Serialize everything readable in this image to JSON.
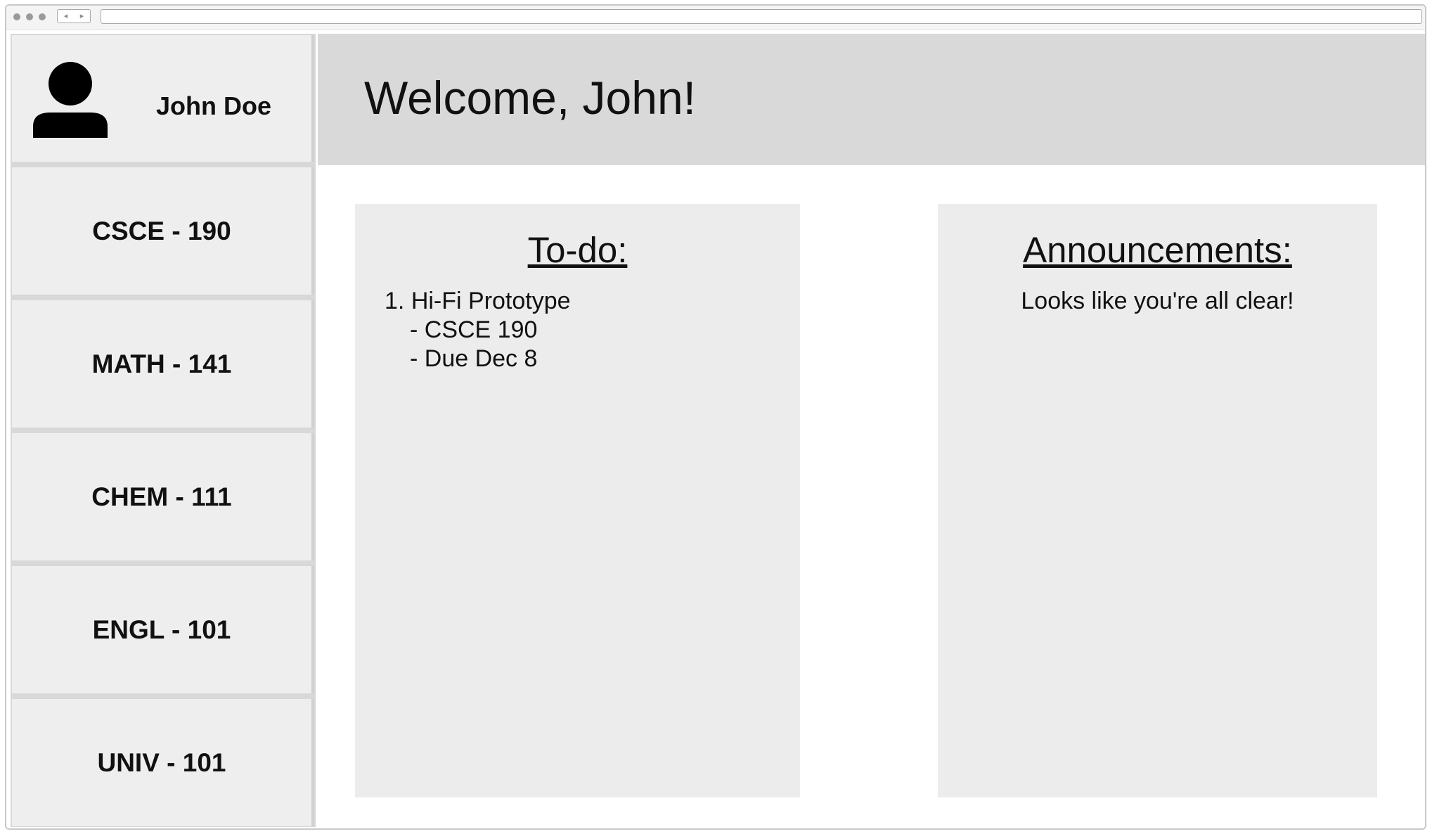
{
  "browser": {
    "back_glyph": "◂",
    "forward_glyph": "▸"
  },
  "sidebar": {
    "user_name": "John Doe",
    "avatar_icon": "user-icon",
    "courses": [
      {
        "label": "CSCE - 190"
      },
      {
        "label": "MATH - 141"
      },
      {
        "label": "CHEM - 111"
      },
      {
        "label": "ENGL - 101"
      },
      {
        "label": "UNIV - 101"
      }
    ]
  },
  "header": {
    "welcome": "Welcome, John!"
  },
  "todo": {
    "title": "To-do:",
    "items": [
      {
        "number": "1.",
        "name": "Hi-Fi Prototype",
        "course": "- CSCE 190",
        "due": "- Due Dec 8"
      }
    ]
  },
  "announcements": {
    "title": "Announcements:",
    "message": "Looks like you're all clear!"
  },
  "colors": {
    "header_bg": "#d9d9d9",
    "sidebar_item_bg": "#eeeeee",
    "panel_bg": "#ececec",
    "text": "#111111"
  }
}
